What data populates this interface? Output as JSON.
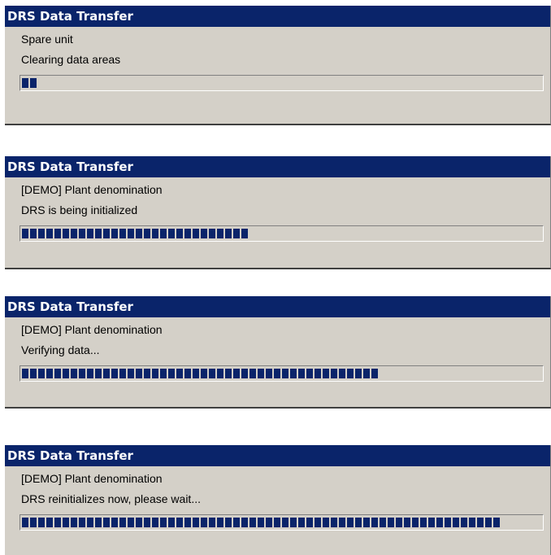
{
  "dialogs": [
    {
      "title": "DRS Data Transfer",
      "line1": "Spare unit",
      "line2": "Clearing data areas",
      "progress_fraction": 0.032
    },
    {
      "title": "DRS Data Transfer",
      "line1": "[DEMO]  Plant denomination",
      "line2": "DRS is being initialized",
      "progress_fraction": 0.435
    },
    {
      "title": "DRS Data Transfer",
      "line1": "[DEMO]  Plant denomination",
      "line2": "Verifying data...",
      "progress_fraction": 0.69
    },
    {
      "title": "DRS Data Transfer",
      "line1": "[DEMO]  Plant denomination",
      "line2": "DRS reinitializes now, please wait...",
      "progress_fraction": 0.925
    }
  ],
  "colors": {
    "titlebar": "#0a246a",
    "face": "#d4d0c8",
    "progress_block": "#0a246a"
  }
}
